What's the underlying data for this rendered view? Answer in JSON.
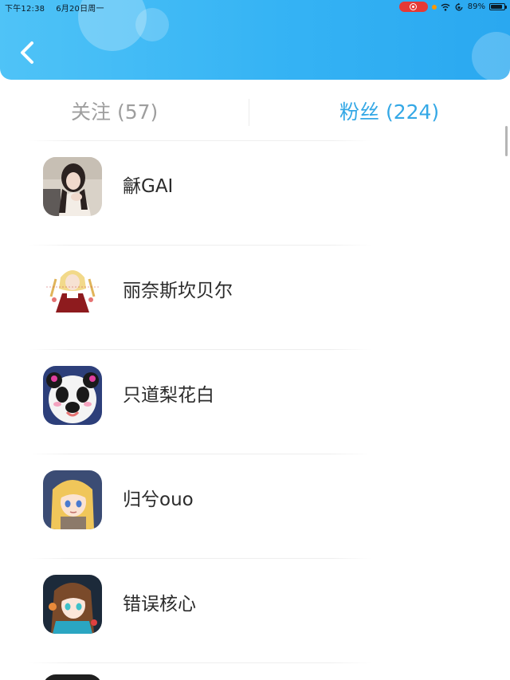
{
  "status_bar": {
    "time": "下午12:38",
    "date": "6月20日周一",
    "battery": "89%",
    "battery_level": 0.89,
    "record_color": "#e53935"
  },
  "header": {
    "back_icon": "chevron-left-icon",
    "gradient_colors": [
      "#4fc3f7",
      "#2aa8f0"
    ]
  },
  "tabs": [
    {
      "label": "关注 (57)",
      "active": false
    },
    {
      "label": "粉丝 (224)",
      "active": true
    }
  ],
  "accent_color": "#34a8e6",
  "users": [
    {
      "name": "龢GAI",
      "avatar": "avatar-photo-girl"
    },
    {
      "name": "丽奈斯坎贝尔",
      "avatar": "avatar-anime-girl-red-dress"
    },
    {
      "name": "只道梨花白",
      "avatar": "avatar-panda"
    },
    {
      "name": "归兮ouo",
      "avatar": "avatar-anime-blonde-girl"
    },
    {
      "name": "错误核心",
      "avatar": "avatar-anime-brown-hair-girl"
    }
  ]
}
